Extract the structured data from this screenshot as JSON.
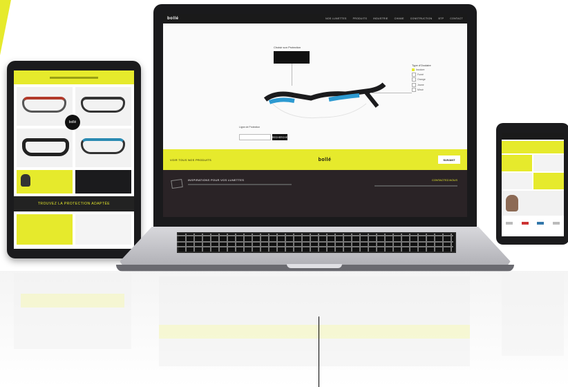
{
  "colors": {
    "accent": "#e6ea2c",
    "dark": "#1a1a1c",
    "footer": "#2a2326"
  },
  "laptop": {
    "logo": "bollé",
    "nav": [
      "NOS LUNETTES",
      "PRODUITS",
      "INDUSTRIE",
      "CHIMIE",
      "CONSTRUCTION",
      "BTP",
      "CONTACT"
    ],
    "callout_left_title": "Choisir son Protection",
    "callout_right_title": "Type d'Oculaire",
    "options": [
      "Incolore",
      "Fumé",
      "Orange",
      "Jaune",
      "Miroir"
    ],
    "field_label": "Ligne de Protection",
    "search_button": "RECHERCHE",
    "bar_link": "VOIR TOUS NOS PRODUITS",
    "bar_brand": "bollé",
    "bar_button": "SUIVANT",
    "footer_title": "INSPIRATIONS POUR VOS LUNETTES",
    "footer_contact": "CONTACTEZ-NOUS"
  },
  "tablet": {
    "badge": "bollé",
    "banner_text": "TROUVEZ LA PROTECTION ADAPTÉE"
  },
  "phone": {}
}
